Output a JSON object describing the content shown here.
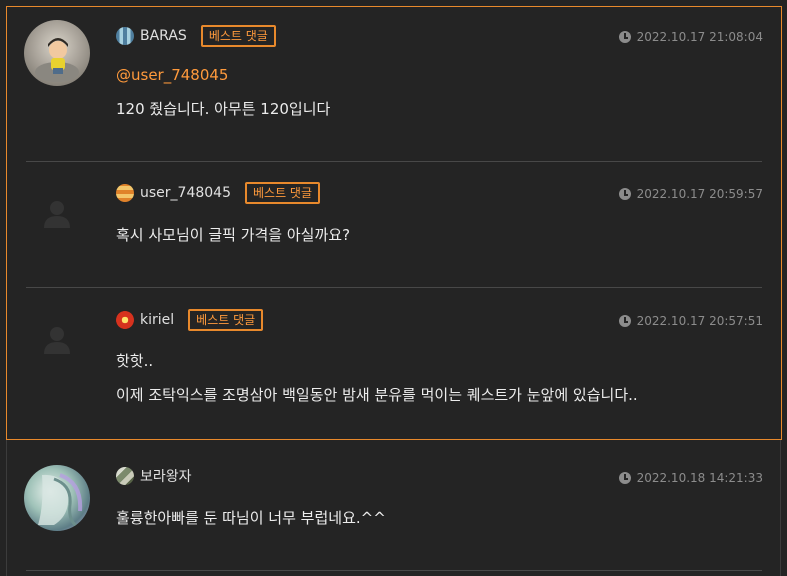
{
  "comments": [
    {
      "username": "BARAS",
      "badge": "베스트 댓글",
      "timestamp": "2022.10.17 21:08:04",
      "mention": "@user_748045",
      "lines": [
        "120 줬습니다. 아무튼 120입니다"
      ]
    },
    {
      "username": "user_748045",
      "badge": "베스트 댓글",
      "timestamp": "2022.10.17 20:59:57",
      "lines": [
        "혹시 사모님이 글픽 가격을 아실까요?"
      ]
    },
    {
      "username": "kiriel",
      "badge": "베스트 댓글",
      "timestamp": "2022.10.17 20:57:51",
      "lines": [
        "핫핫..",
        "이제 조탁익스를 조명삼아 백일동안 밤새 분유를 먹이는 퀘스트가 눈앞에 있습니다.."
      ]
    },
    {
      "username": "보라왕자",
      "timestamp": "2022.10.18 14:21:33",
      "lines": [
        "훌륭한아빠를 둔 따님이 너무 부럽네요.^^"
      ]
    }
  ],
  "colors": {
    "accent": "#e8892c",
    "background": "#242424",
    "muted": "#8c8c8c"
  },
  "icons": {
    "timestamp": "clock-icon",
    "default_avatar": "person-silhouette-icon"
  }
}
